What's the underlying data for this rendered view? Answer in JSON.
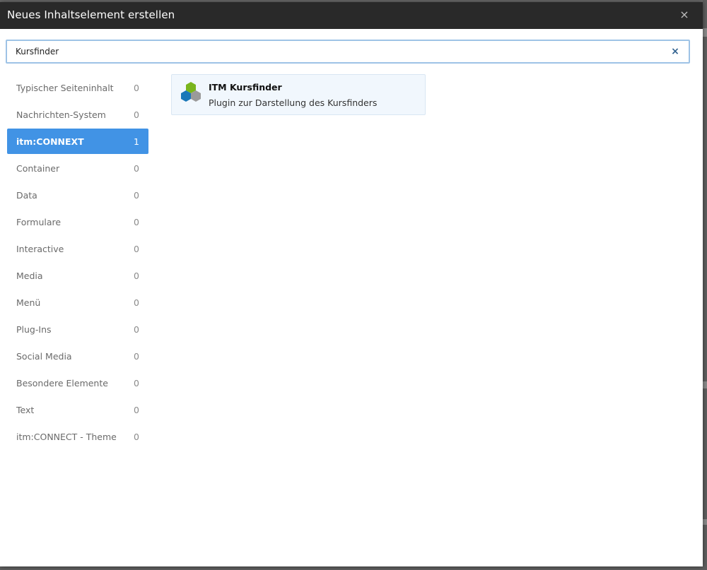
{
  "dialog": {
    "title": "Neues Inhaltselement erstellen",
    "close_symbol": "×"
  },
  "search": {
    "value": "Kursfinder",
    "clear_symbol": "×"
  },
  "categories": [
    {
      "label": "Typischer Seiteninhalt",
      "count": "0",
      "active": false
    },
    {
      "label": "Nachrichten-System",
      "count": "0",
      "active": false
    },
    {
      "label": "itm:CONNEXT",
      "count": "1",
      "active": true
    },
    {
      "label": "Container",
      "count": "0",
      "active": false
    },
    {
      "label": "Data",
      "count": "0",
      "active": false
    },
    {
      "label": "Formulare",
      "count": "0",
      "active": false
    },
    {
      "label": "Interactive",
      "count": "0",
      "active": false
    },
    {
      "label": "Media",
      "count": "0",
      "active": false
    },
    {
      "label": "Menü",
      "count": "0",
      "active": false
    },
    {
      "label": "Plug-Ins",
      "count": "0",
      "active": false
    },
    {
      "label": "Social Media",
      "count": "0",
      "active": false
    },
    {
      "label": "Besondere Elemente",
      "count": "0",
      "active": false
    },
    {
      "label": "Text",
      "count": "0",
      "active": false
    },
    {
      "label": "itm:CONNECT - Theme",
      "count": "0",
      "active": false
    }
  ],
  "results": [
    {
      "title": "ITM Kursfinder",
      "description": "Plugin zur Darstellung des Kursfinders",
      "icon": "hexagon-cluster-icon"
    }
  ],
  "colors": {
    "header_bg": "#292929",
    "active_category": "#4193e5",
    "hex_green": "#7ab51d",
    "hex_blue": "#1a78b8",
    "hex_gray": "#9a9a9a"
  }
}
